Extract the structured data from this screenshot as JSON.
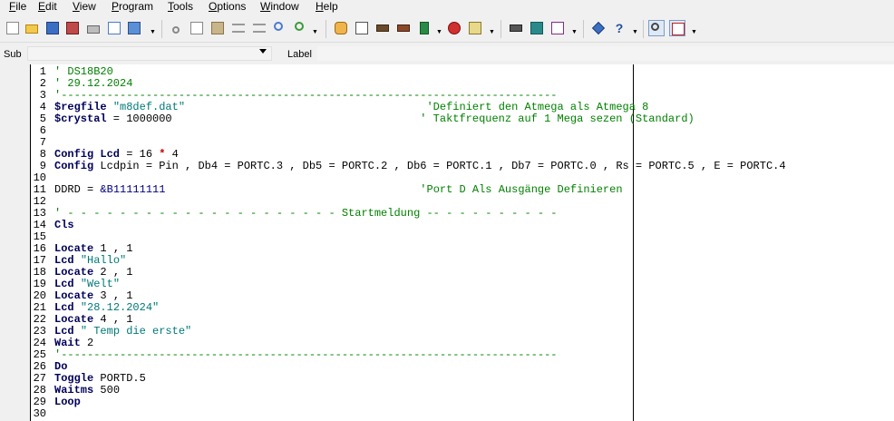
{
  "menu": [
    {
      "id": "file",
      "label": "File"
    },
    {
      "id": "edit",
      "label": "Edit"
    },
    {
      "id": "view",
      "label": "View"
    },
    {
      "id": "program",
      "label": "Program"
    },
    {
      "id": "tools",
      "label": "Tools"
    },
    {
      "id": "options",
      "label": "Options"
    },
    {
      "id": "window",
      "label": "Window"
    },
    {
      "id": "help",
      "label": "Help"
    }
  ],
  "subbar": {
    "sub_label": "Sub",
    "sub_value": "",
    "label_label": "Label",
    "label_value": ""
  },
  "toolbar_icons": [
    "new-file-icon",
    "open-folder-icon",
    "save-icon",
    "save-all-icon",
    "print-icon",
    "print-preview-icon",
    "export-icon",
    "cut-icon",
    "copy-icon",
    "paste-icon",
    "indent-icon",
    "outdent-icon",
    "find-icon",
    "find-next-icon",
    "hand-icon",
    "check-syntax-icon",
    "compile-icon",
    "program-chip-icon",
    "programmer-icon",
    "stop-icon",
    "simulator-icon",
    "lcd-designer-icon",
    "terminal-icon",
    "graph-icon",
    "info-icon",
    "help-icon",
    "zoom-icon",
    "pdf-icon"
  ],
  "colors": {
    "keyword": "#00005a",
    "string": "#007878",
    "comment": "#008000",
    "number": "#000000",
    "hex": "#000080",
    "operator": "#cc0000"
  },
  "code": [
    {
      "n": "1",
      "tokens": [
        [
          "cm",
          "' DS18B20"
        ]
      ]
    },
    {
      "n": "2",
      "tokens": [
        [
          "cm",
          "' 29.12.2024"
        ]
      ]
    },
    {
      "n": "3",
      "tokens": [
        [
          "cm",
          "'----------------------------------------------------------------------------"
        ]
      ]
    },
    {
      "n": "4",
      "tokens": [
        [
          "kw",
          "$regfile"
        ],
        [
          "plain",
          " "
        ],
        [
          "str",
          "\"m8def.dat\""
        ],
        [
          "plain",
          "                                     "
        ],
        [
          "cm",
          "'Definiert den Atmega als Atmega 8"
        ]
      ]
    },
    {
      "n": "5",
      "tokens": [
        [
          "kw",
          "$crystal"
        ],
        [
          "plain",
          " = 1000000                                      "
        ],
        [
          "cm",
          "' Taktfrequenz auf 1 Mega sezen (Standard)"
        ]
      ]
    },
    {
      "n": "6",
      "tokens": []
    },
    {
      "n": "7",
      "tokens": []
    },
    {
      "n": "8",
      "tokens": [
        [
          "kw",
          "Config Lcd"
        ],
        [
          "plain",
          " = 16 "
        ],
        [
          "op",
          "*"
        ],
        [
          "plain",
          " 4"
        ]
      ]
    },
    {
      "n": "9",
      "tokens": [
        [
          "kw",
          "Config"
        ],
        [
          "plain",
          " Lcdpin = Pin , Db4 = PORTC.3 , Db5 = PORTC.2 , Db6 = PORTC.1 , Db7 = PORTC.0 , Rs = PORTC.5 , E = PORTC.4"
        ]
      ]
    },
    {
      "n": "10",
      "tokens": []
    },
    {
      "n": "11",
      "tokens": [
        [
          "plain",
          "DDRD = "
        ],
        [
          "hx",
          "&B11111111"
        ],
        [
          "plain",
          "                                       "
        ],
        [
          "cm",
          "'Port D Als Ausgänge Definieren"
        ]
      ]
    },
    {
      "n": "12",
      "tokens": []
    },
    {
      "n": "13",
      "tokens": [
        [
          "cm",
          "' - - - - - - - - - - - - - - - - - - - - - Startmeldung -- - - - - - - - - -"
        ]
      ]
    },
    {
      "n": "14",
      "tokens": [
        [
          "kw",
          "Cls"
        ]
      ]
    },
    {
      "n": "15",
      "tokens": []
    },
    {
      "n": "16",
      "tokens": [
        [
          "kw",
          "Locate"
        ],
        [
          "plain",
          " 1 , 1"
        ]
      ]
    },
    {
      "n": "17",
      "tokens": [
        [
          "kw",
          "Lcd"
        ],
        [
          "plain",
          " "
        ],
        [
          "str",
          "\"Hallo\""
        ]
      ]
    },
    {
      "n": "18",
      "tokens": [
        [
          "kw",
          "Locate"
        ],
        [
          "plain",
          " 2 , 1"
        ]
      ]
    },
    {
      "n": "19",
      "tokens": [
        [
          "kw",
          "Lcd"
        ],
        [
          "plain",
          " "
        ],
        [
          "str",
          "\"Welt\""
        ]
      ]
    },
    {
      "n": "20",
      "tokens": [
        [
          "kw",
          "Locate"
        ],
        [
          "plain",
          " 3 , 1"
        ]
      ]
    },
    {
      "n": "21",
      "tokens": [
        [
          "kw",
          "Lcd"
        ],
        [
          "plain",
          " "
        ],
        [
          "str",
          "\"28.12.2024\""
        ]
      ]
    },
    {
      "n": "22",
      "tokens": [
        [
          "kw",
          "Locate"
        ],
        [
          "plain",
          " 4 , 1"
        ]
      ]
    },
    {
      "n": "23",
      "tokens": [
        [
          "kw",
          "Lcd"
        ],
        [
          "plain",
          " "
        ],
        [
          "str",
          "\" Temp die erste\""
        ]
      ]
    },
    {
      "n": "24",
      "tokens": [
        [
          "kw",
          "Wait"
        ],
        [
          "plain",
          " 2"
        ]
      ]
    },
    {
      "n": "25",
      "tokens": [
        [
          "cm",
          "'----------------------------------------------------------------------------"
        ]
      ]
    },
    {
      "n": "26",
      "tokens": [
        [
          "kw",
          "Do"
        ]
      ]
    },
    {
      "n": "27",
      "tokens": [
        [
          "kw",
          "Toggle"
        ],
        [
          "plain",
          " PORTD.5"
        ]
      ]
    },
    {
      "n": "28",
      "tokens": [
        [
          "kw",
          "Waitms"
        ],
        [
          "plain",
          " 500"
        ]
      ]
    },
    {
      "n": "29",
      "tokens": [
        [
          "kw",
          "Loop"
        ]
      ]
    },
    {
      "n": "30",
      "tokens": []
    }
  ]
}
